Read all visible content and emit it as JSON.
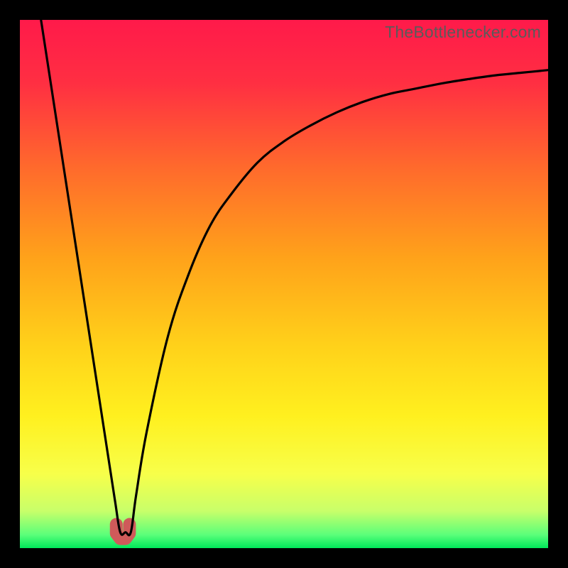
{
  "watermark": "TheBottlenecker.com",
  "chart_data": {
    "type": "line",
    "title": "",
    "xlabel": "",
    "ylabel": "",
    "xlim": [
      0,
      100
    ],
    "ylim": [
      0,
      100
    ],
    "series": [
      {
        "name": "bottleneck-curve",
        "x": [
          4,
          6,
          8,
          10,
          12,
          14,
          16,
          18,
          19,
          20,
          21,
          22,
          24,
          28,
          32,
          36,
          40,
          45,
          50,
          55,
          60,
          65,
          70,
          75,
          80,
          85,
          90,
          95,
          100
        ],
        "y": [
          100,
          87,
          74,
          61,
          48,
          35,
          22,
          9,
          3,
          3,
          3,
          10,
          22,
          40,
          52,
          61,
          67,
          73,
          77,
          80,
          82.5,
          84.5,
          86,
          87,
          88,
          88.8,
          89.5,
          90,
          90.5
        ]
      }
    ],
    "marker": {
      "name": "optimal-region-marker",
      "x_center": 19.5,
      "width": 2.5,
      "color": "#cf5a5a"
    },
    "gradient_stops": [
      {
        "pos": 0.0,
        "color": "#ff1a4a"
      },
      {
        "pos": 0.12,
        "color": "#ff2f42"
      },
      {
        "pos": 0.28,
        "color": "#ff6a2c"
      },
      {
        "pos": 0.45,
        "color": "#ffa21a"
      },
      {
        "pos": 0.62,
        "color": "#ffd21a"
      },
      {
        "pos": 0.75,
        "color": "#fff01f"
      },
      {
        "pos": 0.86,
        "color": "#f7ff4a"
      },
      {
        "pos": 0.93,
        "color": "#c8ff6a"
      },
      {
        "pos": 0.975,
        "color": "#5aff7a"
      },
      {
        "pos": 1.0,
        "color": "#00e85a"
      }
    ]
  }
}
